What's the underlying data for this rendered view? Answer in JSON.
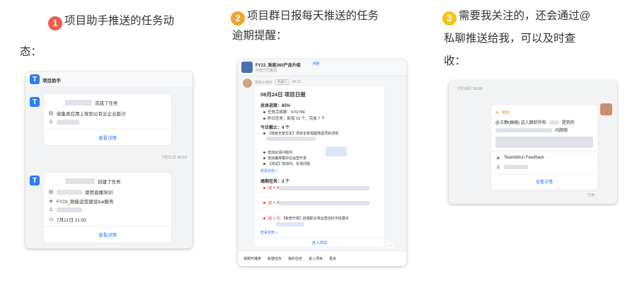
{
  "captions": {
    "c1": {
      "num": "1",
      "text": "项目助手推送的任务动",
      "cont": "态："
    },
    "c2": {
      "num": "2",
      "text": "项目群日报每天推送的任务",
      "cont": "逾期提醒："
    },
    "c3": {
      "num": "3",
      "line1": "需要我关注的，还会通过@",
      "line2": "私聊推送给我，可以及时查",
      "line3": "收："
    }
  },
  "shot1": {
    "header_title": "项目助手",
    "card1": {
      "action": "完成了任务",
      "task": "收集表应用上架到公有云企业版讨",
      "view": "查看详情"
    },
    "timestamp": "7月21日 09:53",
    "card2": {
      "action": "创建了任务",
      "task": "使用直播培训",
      "project": "FY23_致能运营建设&ai服务",
      "date": "7月21日 21:00",
      "view": "查看详情"
    }
  },
  "shot2": {
    "group_title": "FY23_致能360产品升级",
    "group_badge": "内部",
    "group_sub": "阿里巴巴集团",
    "bot_name": "项目小助手",
    "bot_tag": "机器人",
    "time": "08:13",
    "report_title": "08月24日 项目日报",
    "progress": {
      "label": "总体进度：85%",
      "items": [
        "任务完成数：670/786",
        "昨日任务：新增 16 个，完成 7 个"
      ]
    },
    "due_today": {
      "label": "今日截止：4 个",
      "items": [
        "【效能全景优化】项目全景视图筛选项目详情",
        "增加反馈问题列",
        "增加编排模块在运营开发",
        "【测试】增加列、反馈问题"
      ],
      "view_all": "查看全部 »"
    },
    "overdue": {
      "label": "逾期任务：3 个",
      "items": [
        {
          "tag": "[逾 4 天]",
          "text": ""
        },
        {
          "tag": "[逾 4 天]",
          "text": ""
        },
        {
          "tag": "[逾 1 天]",
          "text": "【新增开发】前端配合将运营自检字段展示"
        }
      ],
      "view_all": "查看全部 »"
    },
    "enter": "进入项目",
    "more": "···",
    "toolbar": [
      "视频开播表",
      "新建任务",
      "我的任务",
      "进入项目",
      "更多"
    ]
  },
  "shot3": {
    "datetime": "7月19日 18:58",
    "tag": "项目",
    "message_prefix": "@王静(娓娓) 这儿跟踪你和",
    "message_mid": "提到的",
    "message_end": "问题哦",
    "source": "Teambition Feedback",
    "view": "查看详情",
    "read": "已读"
  },
  "colors": {
    "accent": "#2f7df6",
    "overdue": "#e5443a",
    "orange": "#f08a24"
  }
}
